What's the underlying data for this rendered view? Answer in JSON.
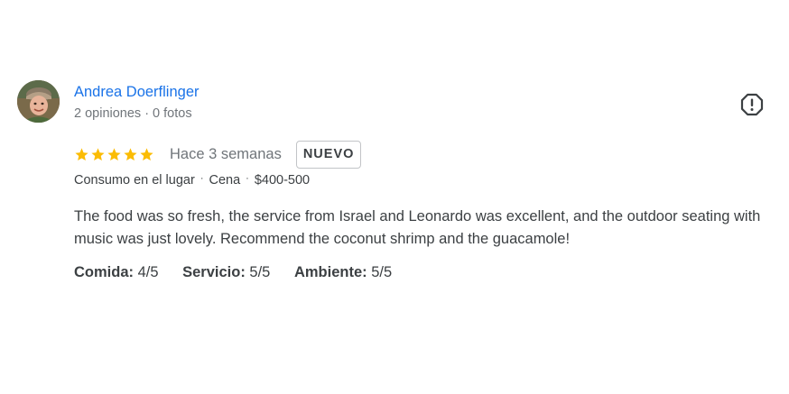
{
  "reviewer": {
    "name": "Andrea Doerflinger",
    "meta": "2 opiniones · 0 fotos"
  },
  "rating": {
    "stars": 5,
    "max_stars": 5,
    "star_color": "#fbbc04",
    "time_ago": "Hace 3 semanas",
    "badge": "NUEVO"
  },
  "tags": {
    "service_type": "Consumo en el lugar",
    "meal_type": "Cena",
    "price": "$400-500",
    "separator": "·"
  },
  "review_text": "The food was so fresh, the service from Israel and Leonardo was excellent, and the outdoor seating with music was just lovely. Recommend the coconut shrimp and the guacamole!",
  "scores": [
    {
      "label": "Comida:",
      "value": "4/5"
    },
    {
      "label": "Servicio:",
      "value": "5/5"
    },
    {
      "label": "Ambiente:",
      "value": "5/5"
    }
  ],
  "colors": {
    "name_link": "#1a73e8",
    "muted_text": "#70757a",
    "body_text": "#3c4043"
  },
  "icons": {
    "report": "report-flag-icon",
    "star": "star-icon"
  }
}
